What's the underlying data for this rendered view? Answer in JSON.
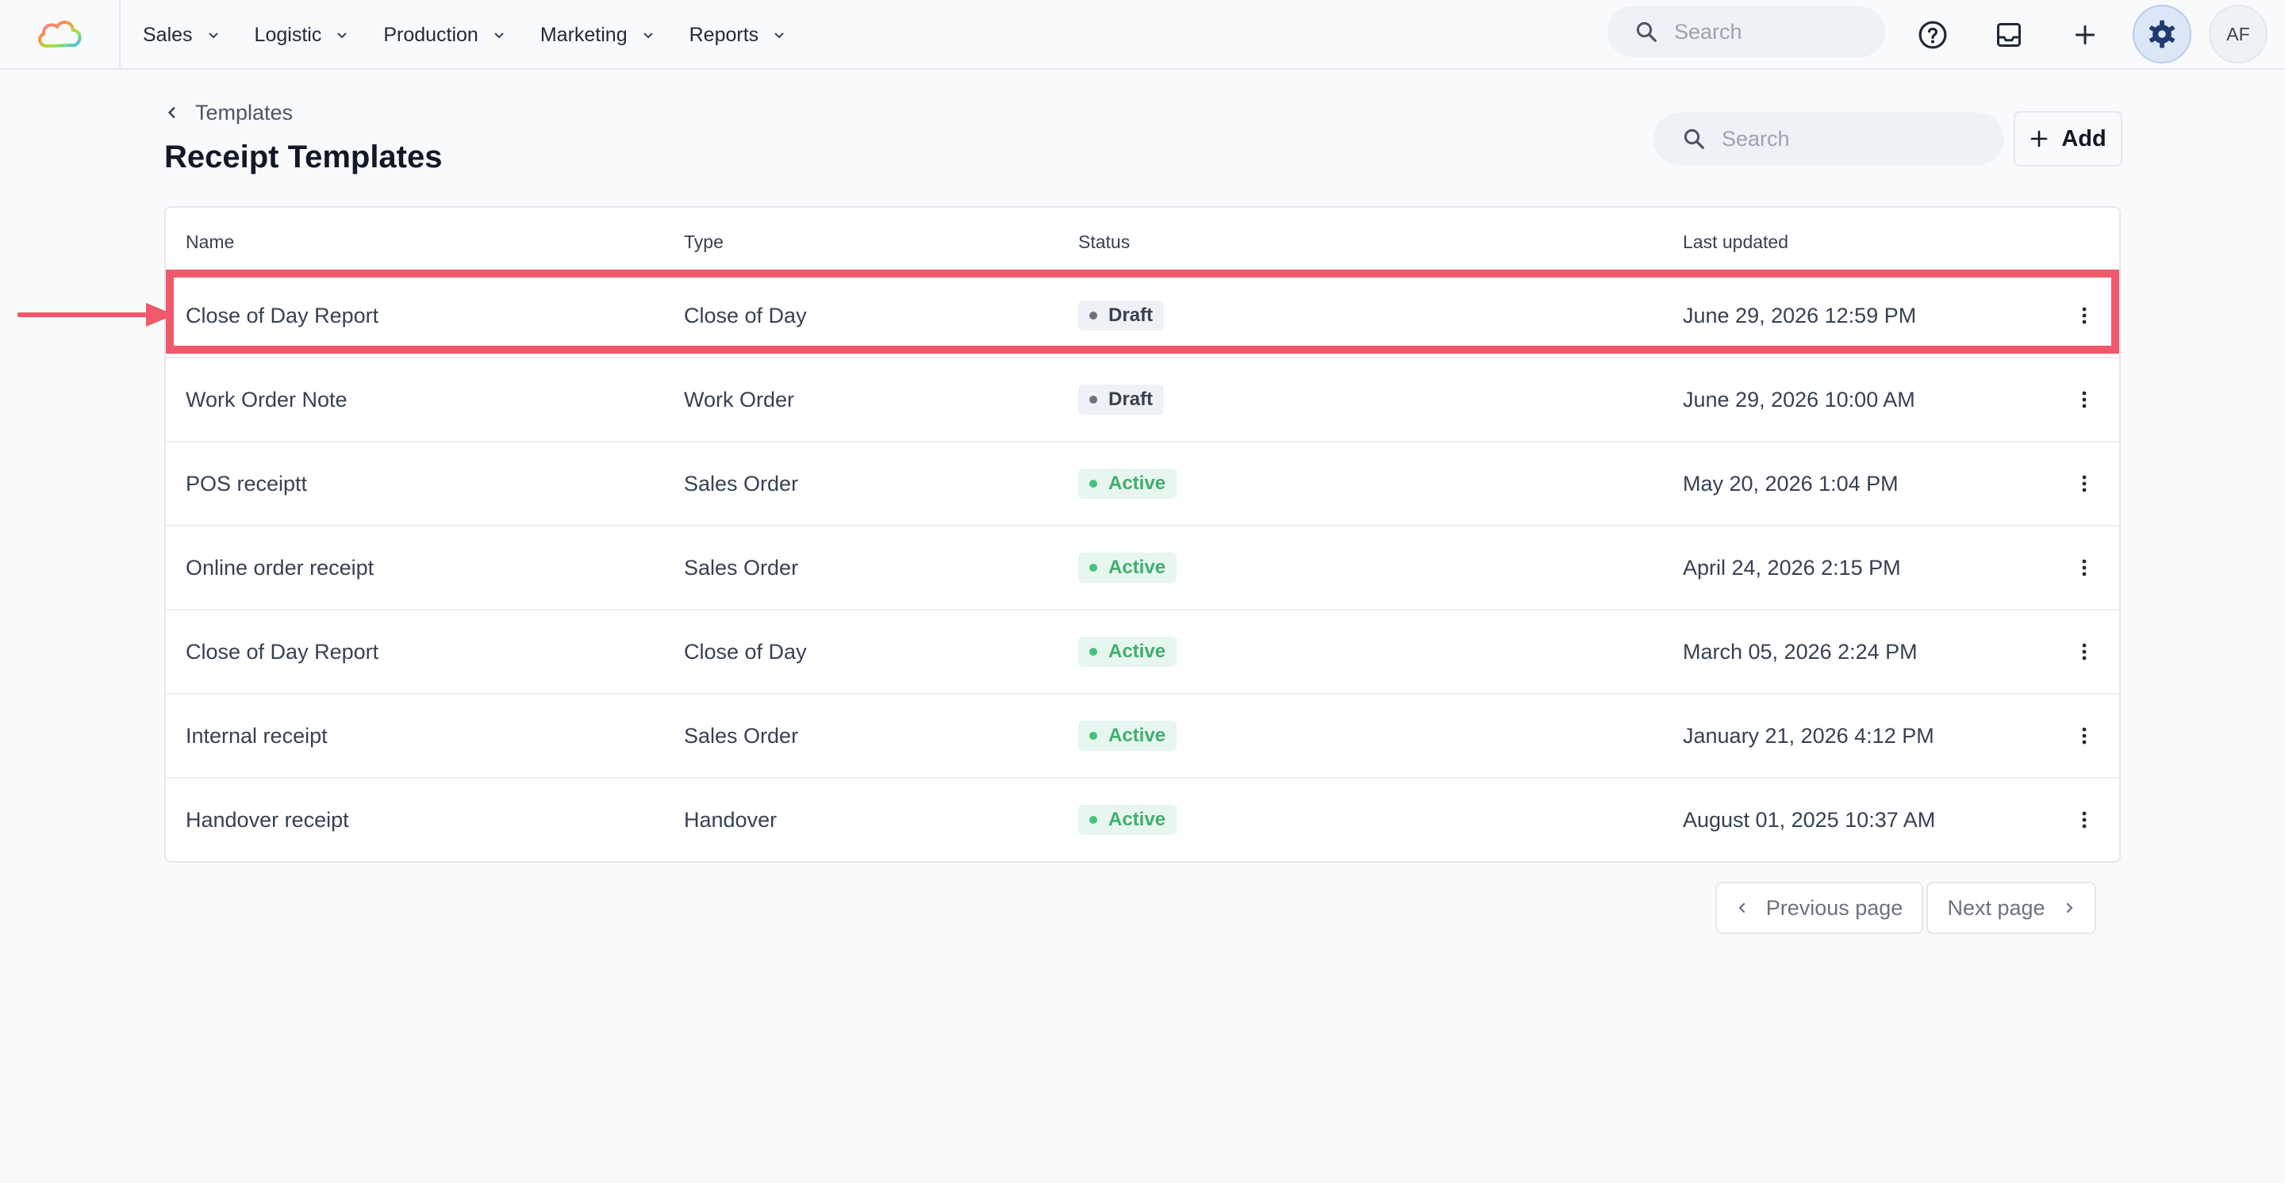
{
  "nav": {
    "items": [
      {
        "label": "Sales"
      },
      {
        "label": "Logistic"
      },
      {
        "label": "Production"
      },
      {
        "label": "Marketing"
      },
      {
        "label": "Reports"
      }
    ],
    "search_placeholder": "Search",
    "avatar_initials": "AF"
  },
  "header": {
    "breadcrumb": "Templates",
    "title": "Receipt Templates",
    "search_placeholder": "Search",
    "add_label": "Add"
  },
  "table": {
    "columns": [
      "Name",
      "Type",
      "Status",
      "Last updated"
    ],
    "rows": [
      {
        "name": "Close of Day Report",
        "type": "Close of Day",
        "status": "Draft",
        "updated": "June 29, 2026 12:59 PM"
      },
      {
        "name": "Work Order Note",
        "type": "Work Order",
        "status": "Draft",
        "updated": "June 29, 2026 10:00 AM"
      },
      {
        "name": "POS receiptt",
        "type": "Sales Order",
        "status": "Active",
        "updated": "May 20, 2026 1:04 PM"
      },
      {
        "name": "Online order receipt",
        "type": "Sales Order",
        "status": "Active",
        "updated": "April 24, 2026 2:15 PM"
      },
      {
        "name": "Close of Day Report",
        "type": "Close of Day",
        "status": "Active",
        "updated": "March 05, 2026 2:24 PM"
      },
      {
        "name": "Internal receipt",
        "type": "Sales Order",
        "status": "Active",
        "updated": "January 21, 2026 4:12 PM"
      },
      {
        "name": "Handover receipt",
        "type": "Handover",
        "status": "Active",
        "updated": "August 01, 2025 10:37 AM"
      }
    ]
  },
  "pagination": {
    "prev_label": "Previous page",
    "next_label": "Next page"
  },
  "colors": {
    "highlight": "#f0596a",
    "active_badge": "#3fae6e",
    "draft_badge": "#374151",
    "gear_accent": "#1e3a6e"
  }
}
